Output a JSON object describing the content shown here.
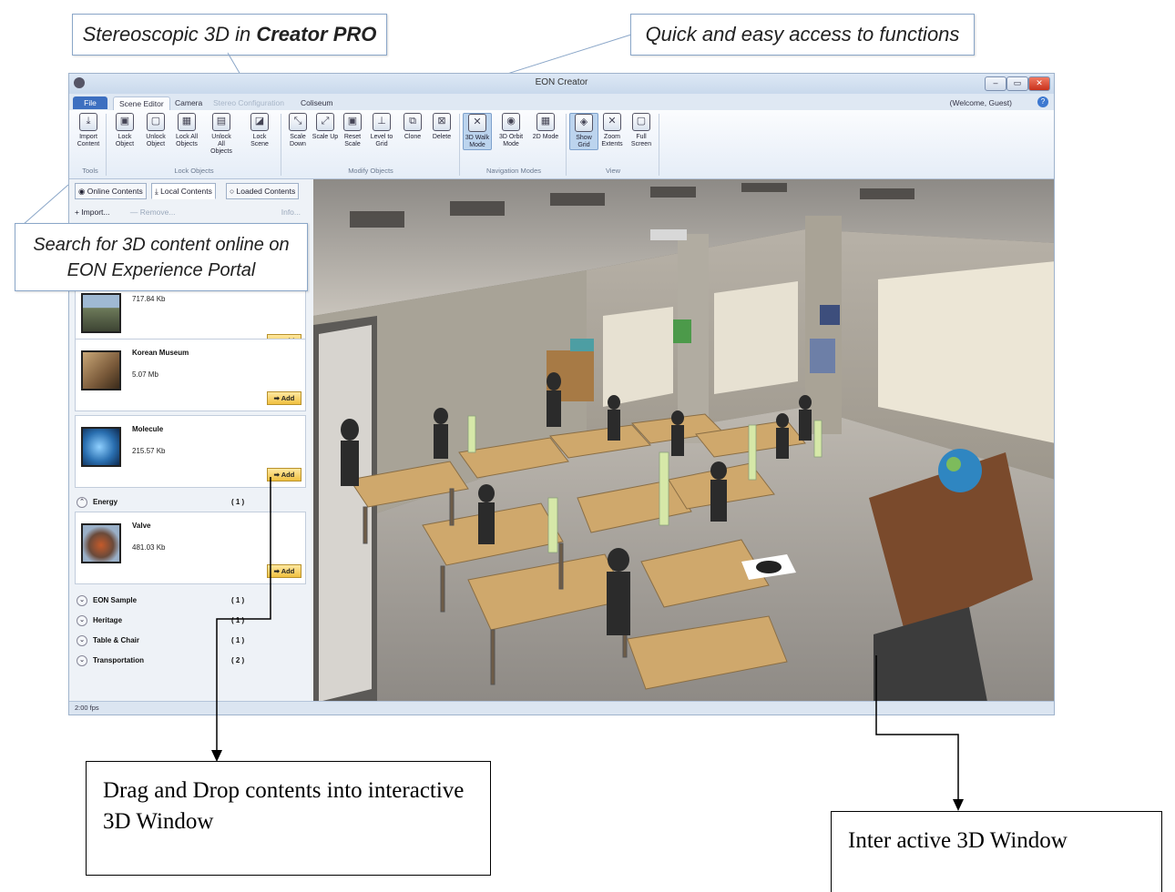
{
  "callouts": {
    "stereo_part1": "Stereoscopic 3D in ",
    "stereo_part2": "Creator PRO",
    "quick": "Quick and easy access to functions",
    "search": "Search for 3D content online on EON Experience Portal",
    "drag": "Drag and Drop contents into interactive 3D Window",
    "interactive": "Inter active 3D Window"
  },
  "window": {
    "title": "EON Creator",
    "welcome": "(Welcome, Guest)"
  },
  "tabs": [
    "File",
    "Scene Editor",
    "Camera",
    "Stereo Configuration",
    "Coliseum"
  ],
  "ribbon": {
    "buttons": [
      {
        "label": "Import Content",
        "icon": "import-icon"
      },
      {
        "label": "Lock Object",
        "icon": "lock-icon"
      },
      {
        "label": "Unlock Object",
        "icon": "unlock-icon"
      },
      {
        "label": "Lock All Objects",
        "icon": "lock-all-icon"
      },
      {
        "label": "Unlock All Objects",
        "icon": "unlock-all-icon"
      },
      {
        "label": "Lock Scene",
        "icon": "lock-scene-icon"
      },
      {
        "label": "Scale Down",
        "icon": "scale-down-icon"
      },
      {
        "label": "Scale Up",
        "icon": "scale-up-icon"
      },
      {
        "label": "Reset Scale",
        "icon": "reset-scale-icon"
      },
      {
        "label": "Level to Grid",
        "icon": "level-icon"
      },
      {
        "label": "Clone",
        "icon": "clone-icon"
      },
      {
        "label": "Delete",
        "icon": "delete-icon"
      },
      {
        "label": "3D Walk Mode",
        "icon": "walk-icon"
      },
      {
        "label": "3D Orbit Mode",
        "icon": "orbit-icon"
      },
      {
        "label": "2D Mode",
        "icon": "grid-2d-icon"
      },
      {
        "label": "Show Grid",
        "icon": "show-grid-icon"
      },
      {
        "label": "Zoom Extents",
        "icon": "zoom-extents-icon"
      },
      {
        "label": "Full Screen",
        "icon": "fullscreen-icon"
      }
    ],
    "groups": [
      "Tools",
      "Lock Objects",
      "Modify Objects",
      "Navigation Modes",
      "View"
    ]
  },
  "panel": {
    "tabs": [
      "Online Contents",
      "Local Contents",
      "Loaded Contents"
    ],
    "import": "+ Import...",
    "remove": "— Remove...",
    "info": "Info...",
    "items": [
      {
        "name": "",
        "size": "717.84 Kb",
        "add": "➡ Add"
      },
      {
        "name": "Korean Museum",
        "size": "5.07 Mb",
        "add": "➡ Add"
      },
      {
        "name": "Molecule",
        "size": "215.57 Kb",
        "add": "➡ Add"
      },
      {
        "name": "Valve",
        "size": "481.03 Kb",
        "add": "➡ Add"
      }
    ],
    "energy": {
      "label": "Energy",
      "count": "( 1 )"
    },
    "categories": [
      {
        "label": "EON Sample",
        "count": "( 1 )"
      },
      {
        "label": "Heritage",
        "count": "( 1 )"
      },
      {
        "label": "Table & Chair",
        "count": "( 1 )"
      },
      {
        "label": "Transportation",
        "count": "( 2 )"
      }
    ]
  },
  "status": "2:00 fps",
  "colors": {
    "ribbon_blue": "#3d6fc0",
    "add_button": "#f0c040"
  }
}
